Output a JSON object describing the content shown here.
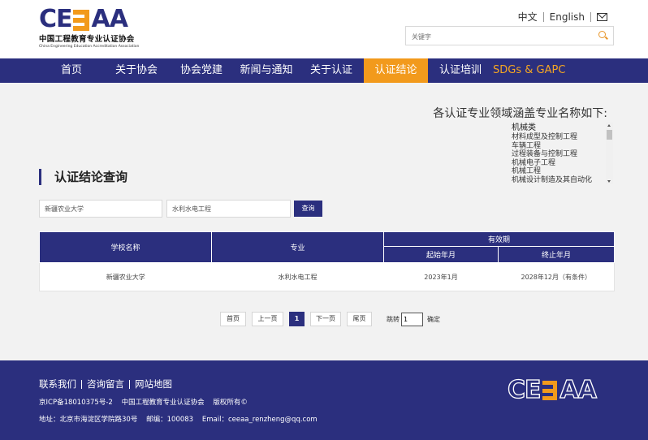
{
  "brand": {
    "logo_cn": "中国工程教育专业认证协会",
    "logo_en": "China Engineering Education Accreditation Association",
    "accent_color": "#f29a1c",
    "primary_color": "#2b2f7e"
  },
  "header": {
    "lang_cn": "中文",
    "lang_en": "English",
    "search_placeholder": "关键字"
  },
  "nav": {
    "items": [
      {
        "label": "首页"
      },
      {
        "label": "关于协会"
      },
      {
        "label": "协会党建"
      },
      {
        "label": "新闻与通知"
      },
      {
        "label": "关于认证"
      },
      {
        "label": "认证结论",
        "active": true
      },
      {
        "label": "认证培训"
      },
      {
        "label": "SDGs & GAPC"
      }
    ]
  },
  "fields": {
    "title": "各认证专业领域涵盖专业名称如下:",
    "category": "机械类",
    "items": [
      "材料成型及控制工程",
      "车辆工程",
      "过程装备与控制工程",
      "机械电子工程",
      "机械工程",
      "机械设计制造及其自动化"
    ]
  },
  "query": {
    "title": "认证结论查询",
    "school_value": "新疆农业大学",
    "major_value": "水利水电工程",
    "button": "查询"
  },
  "table": {
    "headers": {
      "school": "学校名称",
      "major": "专业",
      "validity": "有效期",
      "start": "起始年月",
      "end": "终止年月"
    },
    "rows": [
      {
        "school": "新疆农业大学",
        "major": "水利水电工程",
        "start": "2023年1月",
        "end": "2028年12月（有条件）"
      }
    ]
  },
  "pager": {
    "first": "首页",
    "prev": "上一页",
    "current": "1",
    "next": "下一页",
    "last": "尾页",
    "jump_label": "跳转",
    "jump_value": "1",
    "confirm": "确定"
  },
  "footer": {
    "links": [
      "联系我们",
      "咨询留言",
      "网站地图"
    ],
    "icp": "京ICP备18010375号-2    中国工程教育专业认证协会    版权所有©",
    "address": "地址：北京市海淀区学院路30号    邮编：100083    Email：ceeaa_renzheng@qq.com"
  }
}
